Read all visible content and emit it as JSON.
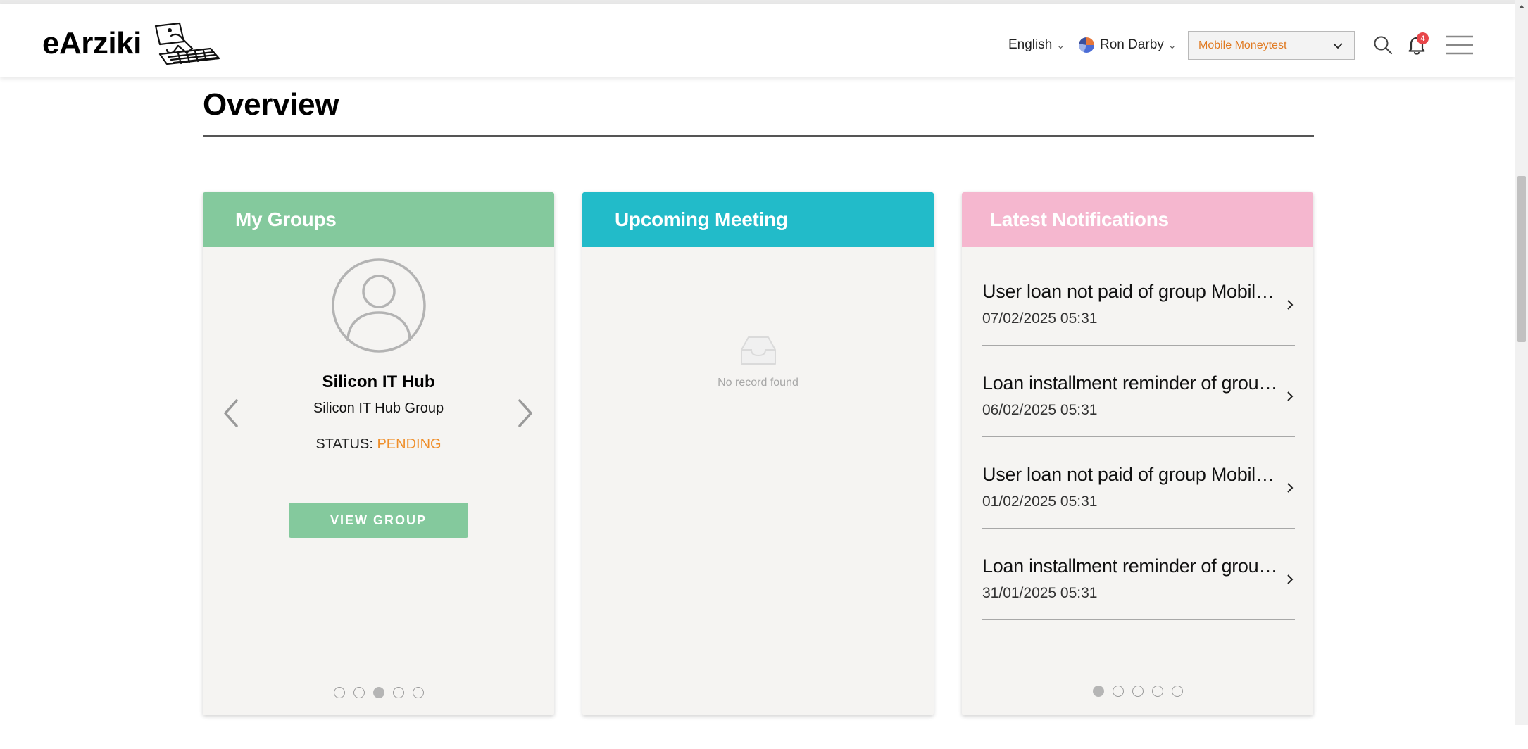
{
  "header": {
    "logo_text": "eArziki",
    "language": "English",
    "user_name": "Ron Darby",
    "account_select": "Mobile Moneytest",
    "notification_count": "4"
  },
  "page": {
    "title": "Overview"
  },
  "groups_card": {
    "title": "My Groups",
    "group_name": "Silicon IT Hub",
    "group_subtitle": "Silicon IT Hub Group",
    "status_label": "STATUS:",
    "status_value": "PENDING",
    "button_label": "VIEW GROUP",
    "pager_total": 5,
    "pager_active": 3
  },
  "meeting_card": {
    "title": "Upcoming Meeting",
    "empty_text": "No record found"
  },
  "notifications_card": {
    "title": "Latest Notifications",
    "items": [
      {
        "title": "User loan not paid of group Mobile Moneytest",
        "date": "07/02/2025 05:31"
      },
      {
        "title": "Loan installment reminder of group Mobile Moneytest",
        "date": "06/02/2025 05:31"
      },
      {
        "title": "User loan not paid of group Mobile Moneytest",
        "date": "01/02/2025 05:31"
      },
      {
        "title": "Loan installment reminder of group Mobile Moneytest",
        "date": "31/01/2025 05:31"
      }
    ],
    "pager_total": 5,
    "pager_active": 1
  },
  "colors": {
    "groups_header": "#84c99d",
    "meeting_header": "#22bbc9",
    "notifications_header": "#f5b7cf",
    "status_pending": "#ef8f2b",
    "account_text": "#e07a22",
    "badge": "#e8464a"
  },
  "icons": {
    "search": "search-icon",
    "bell": "bell-icon",
    "menu": "hamburger-menu-icon",
    "avatar": "user-avatar-icon",
    "empty": "empty-inbox-icon",
    "chevron": "chevron-right-icon"
  }
}
